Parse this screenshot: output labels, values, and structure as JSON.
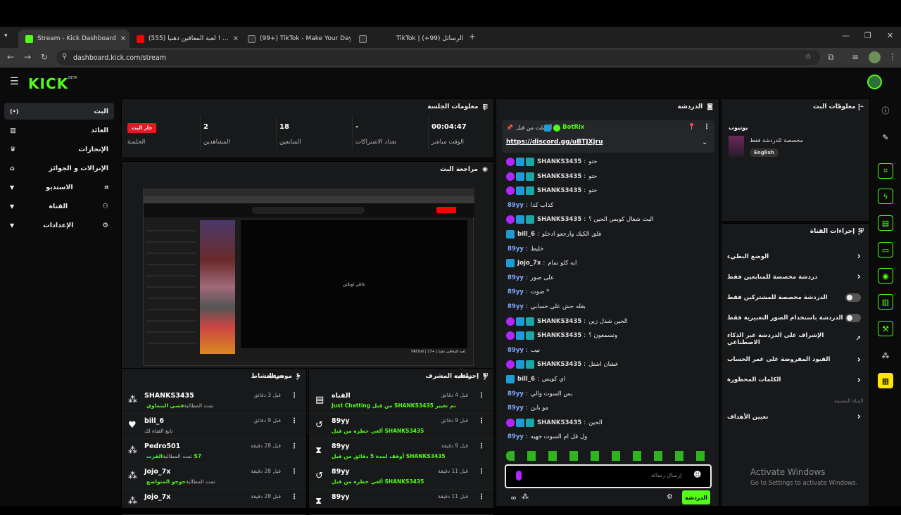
{
  "browser": {
    "tabs": [
      {
        "title": "Stream - Kick Dashboard",
        "color": "#53fc18"
      },
      {
        "title": "(555) لعبة المعاقين ذهنيا ! ...",
        "color": "#ff0000"
      },
      {
        "title": "(99+) TikTok - Make Your Day",
        "color": "#333333"
      },
      {
        "title": "TikTok | الرسائل (99+)",
        "color": "#333333"
      }
    ],
    "url": "dashboard.kick.com/stream"
  },
  "app": {
    "logo": "KICK",
    "beta": "BETA",
    "sidebar": [
      {
        "label": "البث",
        "icon": "(•)"
      },
      {
        "label": "العائد",
        "icon": "▥"
      },
      {
        "label": "الإنجازات",
        "icon": "♛"
      },
      {
        "label": "الإنزالات و الجوائز",
        "icon": "⌂"
      },
      {
        "label": "الاستديو",
        "icon": "⌗"
      },
      {
        "label": "القناة",
        "icon": "⚇"
      },
      {
        "label": "الإعدادات",
        "icon": "⚙"
      }
    ],
    "session": {
      "title": "معلومات الجلسة",
      "stats": [
        {
          "label": "الوقت مباشر",
          "value": "00:04:47"
        },
        {
          "label": "تعداد الاشتراكات",
          "value": "-"
        },
        {
          "label": "المتابعين",
          "value": "18"
        },
        {
          "label": "المشاهدين",
          "value": "2"
        },
        {
          "label": "الجلسة",
          "value": "جار البث"
        }
      ]
    },
    "review": {
      "title": "مراجعة البث",
      "inner_caption": "عائلي اونلاين",
      "inner_bottom": "VRChat | 17+ | لعبة المعاقين ذهنيا"
    },
    "activity": {
      "title": "موجز النشاط",
      "filter": "تصفية",
      "items": [
        {
          "name": "SHANKS3435",
          "sub": "تمت المطالبة",
          "sub_hl": "قصي الينماوي",
          "time": "قبل 3 دقائق",
          "icon": "⁂"
        },
        {
          "name": "bill_6",
          "sub": "تابع القناة لك",
          "sub_hl": "",
          "time": "قبل 9 دقائق",
          "icon": "♥"
        },
        {
          "name": "Pedro501",
          "sub": "تمت المطالبة",
          "sub_hl": "القرت S7",
          "time": "قبل 28 دقيقة",
          "icon": "⁂"
        },
        {
          "name": "Jojo_7x",
          "sub": "تمت المطالبة",
          "sub_hl": "جوجو المتواضع",
          "time": "قبل 28 دقيقة",
          "icon": "⁂"
        },
        {
          "name": "Jojo_7x",
          "sub": "",
          "sub_hl": "",
          "time": "قبل 28 دقيقة",
          "icon": "⁂"
        }
      ]
    },
    "mod": {
      "title": "إجراءات المشرف",
      "filter": "تصفية",
      "items": [
        {
          "name": "القناة",
          "sub": "Just Chatting من قبل SHANKS3435 تم تغيير",
          "time": "قبل 4 دقائق",
          "icon": "▤"
        },
        {
          "name": "89yy",
          "sub": "ألغي حظره من قبل SHANKS3435",
          "time": "قبل 9 دقائق",
          "icon": "↺"
        },
        {
          "name": "89yy",
          "sub": "أوقف لمدة 5 دقائق من قبل SHANKS3435",
          "time": "قبل 9 دقيقة",
          "icon": "⧗"
        },
        {
          "name": "89yy",
          "sub": "ألغي حظره من قبل SHANKS3435",
          "time": "قبل 11 دقيقة",
          "icon": "↺"
        },
        {
          "name": "89yy",
          "sub": "",
          "time": "قبل 11 دقيقة",
          "icon": "⧗"
        }
      ]
    },
    "chat": {
      "title": "الدردشة",
      "pinned_by": "أرسلت من قبل",
      "pinned_user": "BotRix",
      "pinned_link": "https://discord.gg/uBTJXjru",
      "messages": [
        {
          "user": "SHANKS3435",
          "text": "حتو",
          "badges": [
            "mic",
            "mod",
            "sub"
          ],
          "color": "u-gray"
        },
        {
          "user": "SHANKS3435",
          "text": "حتو",
          "badges": [
            "mic",
            "mod",
            "sub"
          ],
          "color": "u-gray"
        },
        {
          "user": "SHANKS3435",
          "text": "حتو",
          "badges": [
            "mic",
            "mod",
            "sub"
          ],
          "color": "u-gray"
        },
        {
          "user": "89yy",
          "text": "كذاب كذا",
          "badges": [],
          "color": "u-blue"
        },
        {
          "user": "SHANKS3435",
          "text": "البث شغال كويس الحين ؟",
          "badges": [
            "mic",
            "mod",
            "sub"
          ],
          "color": "u-gray"
        },
        {
          "user": "bill_6",
          "text": "قلق الكيك وارجعو ادخلو",
          "badges": [
            "mod"
          ],
          "color": "u-gray"
        },
        {
          "user": "89yy",
          "text": "خليط",
          "badges": [],
          "color": "u-blue"
        },
        {
          "user": "Jojo_7x",
          "text": "ايه كلو تمام",
          "badges": [
            "mod"
          ],
          "color": "u-gray"
        },
        {
          "user": "89yy",
          "text": "على صور",
          "badges": [],
          "color": "u-blue"
        },
        {
          "user": "89yy",
          "text": "صوت *",
          "badges": [],
          "color": "u-blue"
        },
        {
          "user": "89yy",
          "text": "بقله حش على حسابي",
          "badges": [],
          "color": "u-blue"
        },
        {
          "user": "SHANKS3435",
          "text": "الحين شذل زين",
          "badges": [
            "mic",
            "mod",
            "sub"
          ],
          "color": "u-gray"
        },
        {
          "user": "SHANKS3435",
          "text": "وتسمعون ؟",
          "badges": [
            "mic",
            "mod",
            "sub"
          ],
          "color": "u-gray"
        },
        {
          "user": "89yy",
          "text": "نيب",
          "badges": [],
          "color": "u-blue"
        },
        {
          "user": "SHANKS3435",
          "text": "عشان اشتل",
          "badges": [
            "mic",
            "mod",
            "sub"
          ],
          "color": "u-gray"
        },
        {
          "user": "bill_6",
          "text": "اي كويس",
          "badges": [
            "mod"
          ],
          "color": "u-gray"
        },
        {
          "user": "89yy",
          "text": "بس السوت والي",
          "badges": [],
          "color": "u-blue"
        },
        {
          "user": "89yy",
          "text": "مو باين",
          "badges": [],
          "color": "u-blue"
        },
        {
          "user": "SHANKS3435",
          "text": "الحين",
          "badges": [
            "mic",
            "mod",
            "sub"
          ],
          "color": "u-gray"
        },
        {
          "user": "89yy",
          "text": "ول قل ام السوت جهيه",
          "badges": [],
          "color": "u-blue"
        }
      ],
      "input_placeholder": "إرسال رسالة",
      "send_label": "الدردشة"
    },
    "stream_info": {
      "title": "معلومات البث",
      "category": "يوتيوب",
      "desc": "مخصصة للدردشة فقط",
      "lang": "English"
    },
    "channel_actions": {
      "title": "إجراءات القناة",
      "items": [
        {
          "label": "الوضع البطيء",
          "control": "chevron"
        },
        {
          "label": "دردشة مخصصة للمتابعين فقط",
          "control": "chevron"
        },
        {
          "label": "الدردشة مخصصة للمشتركين فقط",
          "control": "toggle"
        },
        {
          "label": "الدردشة باستخدام الصور التعبيرية فقط",
          "control": "toggle"
        },
        {
          "label": "الإشراف على الدردشة عبر الذكاء الاصطناعي",
          "control": "external"
        },
        {
          "label": "القيود المفروضة على عمر الحساب",
          "control": "chevron"
        },
        {
          "label": "الكلمات المحظورة",
          "control": "chevron"
        }
      ],
      "section": "القناة المضيفة",
      "host_item": "تعيين الأهداف"
    },
    "watermark": {
      "line1": "Activate Windows",
      "line2": "Go to Settings to activate Windows."
    }
  }
}
